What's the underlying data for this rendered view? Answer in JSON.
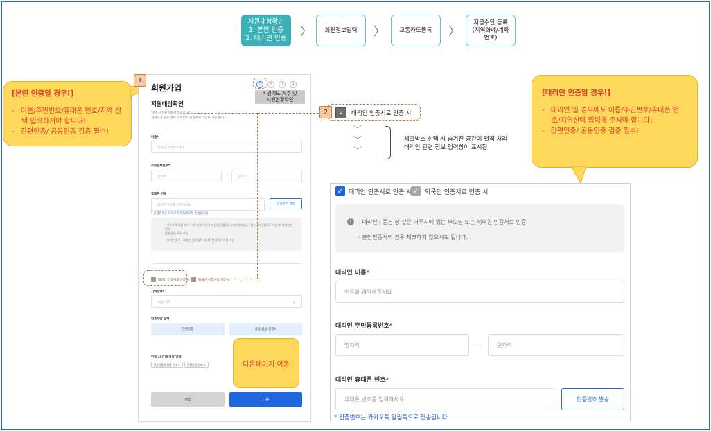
{
  "steps": [
    {
      "label": "지원대상확인\n1. 본인 인증\n2. 대리인 인증"
    },
    {
      "label": "회원정보입력"
    },
    {
      "label": "교통카드등록"
    },
    {
      "label": "지급수단 등록\n(지역화폐/계좌\n번호)"
    }
  ],
  "step_separator": "〉",
  "note_self": {
    "title": "[본인 인증일 경우!]",
    "items": [
      "이름/주민번호/휴대폰 번호/지역 선택 입력하셔야 합니다!",
      "간편인증/ 공동인증 검증 필수!"
    ]
  },
  "note_proxy": {
    "title": "[대리인 인증일 경우!]",
    "items": [
      "대리인 일 경우에도 이름/주민번호/휴대폰 번호/지역선택 입력해 주셔야 합니다!",
      "간편인증/ 공동인증 검증 필수!"
    ]
  },
  "badges": {
    "one": "1",
    "two": "2"
  },
  "form": {
    "title": "회원가입",
    "progress": [
      "1",
      "2",
      "3",
      "4"
    ],
    "tip": "* 경기도 거주 및\n지원현황확인",
    "section_title": "지원대상확인",
    "desc": "가입 시 간편인증이 필요합니다.\n접종자가 없을 경우 대리인의 인증서로 가입이 가능합니다.",
    "name_label": "이름*",
    "name_placeholder": "이름을 입력해주세요",
    "rrn_label": "주민등록번호*",
    "rrn_front": "앞자리",
    "rrn_back": "뒷자리",
    "rrn_dash": "—",
    "phone_label": "휴대폰 번호",
    "phone_placeholder": "휴대폰 번호를 입력하세요",
    "phone_btn": "인증번호 발송",
    "phone_hint": "* 인증번호는 카카오톡 알림톡으로 전송됩니다.",
    "info_line1": "· 거주지 확인을 위해 · 어르신의 주소지 본인인증 필요함, 대리인(부모님 / 없는 경우) 인증도 가능(본 대리인만 필요",
    "info_line2": "한 본인은 모두 가능",
    "info_line3": "· 대리인 등록 · 대리인 인증 입력 절차로 변경하여 이용 가능",
    "cb_proxy": "대리인 인증서로 인증 시",
    "cb_foreign": "외국인 인증서로 인증 시",
    "region_label": "지역선택*",
    "region_placeholder": "시/군 선택",
    "auth_label": "인증수단 선택",
    "auth_simple": "간편인증",
    "auth_joint": "공동·금융 인증서",
    "guide_label": "인증 시 안내 사항 안내",
    "chip1": "공동인증서 발급 안내 >",
    "chip2": "간편인증 안내 >",
    "cancel": "취소",
    "next": "다음"
  },
  "next_page_note": "다음페이지 이동",
  "mid": {
    "checkbox_mark": "v",
    "label": "대리인 인증서로 인증 시",
    "arrows": [
      "﹀",
      "﹀",
      "﹀"
    ],
    "explain": "체크박스 선택 시 숨겨진 공간이 펼침 처리\n대리인 관련 정보 입력창이 표시됨"
  },
  "detail": {
    "cb_proxy": "대리인 인증서로 인증 시",
    "cb_foreign": "외국인 인증서로 인증 시",
    "check_mark": "✓",
    "info_line1": "- 대리인 : 등본 상 같은 거주지에 있는 부모님 또는 세대원 인증서로 인증",
    "info_line2": "- 본인인증서의 경우 체크하지 않으셔도 됩니다.",
    "name_label": "대리인 이름",
    "name_placeholder": "이름을 입력해주세요",
    "rrn_label": "대리인 주민등록번호",
    "rrn_front": "앞자리",
    "rrn_back": "뒷자리",
    "rrn_dash": "—",
    "phone_label": "대리인 휴대폰 번호",
    "phone_placeholder": "휴대폰 번호를 입력하세요.",
    "phone_btn": "인증번호 발송",
    "req": "*",
    "hint": "* 인증번호는 카카오톡 알림톡으로 전송됩니다."
  },
  "colors": {
    "frame": "#3a5bd9",
    "teal": "#3bb0b6",
    "note_yellow": "#fdd85a",
    "note_text": "#e13b2d",
    "primary_blue": "#1f67e0"
  }
}
